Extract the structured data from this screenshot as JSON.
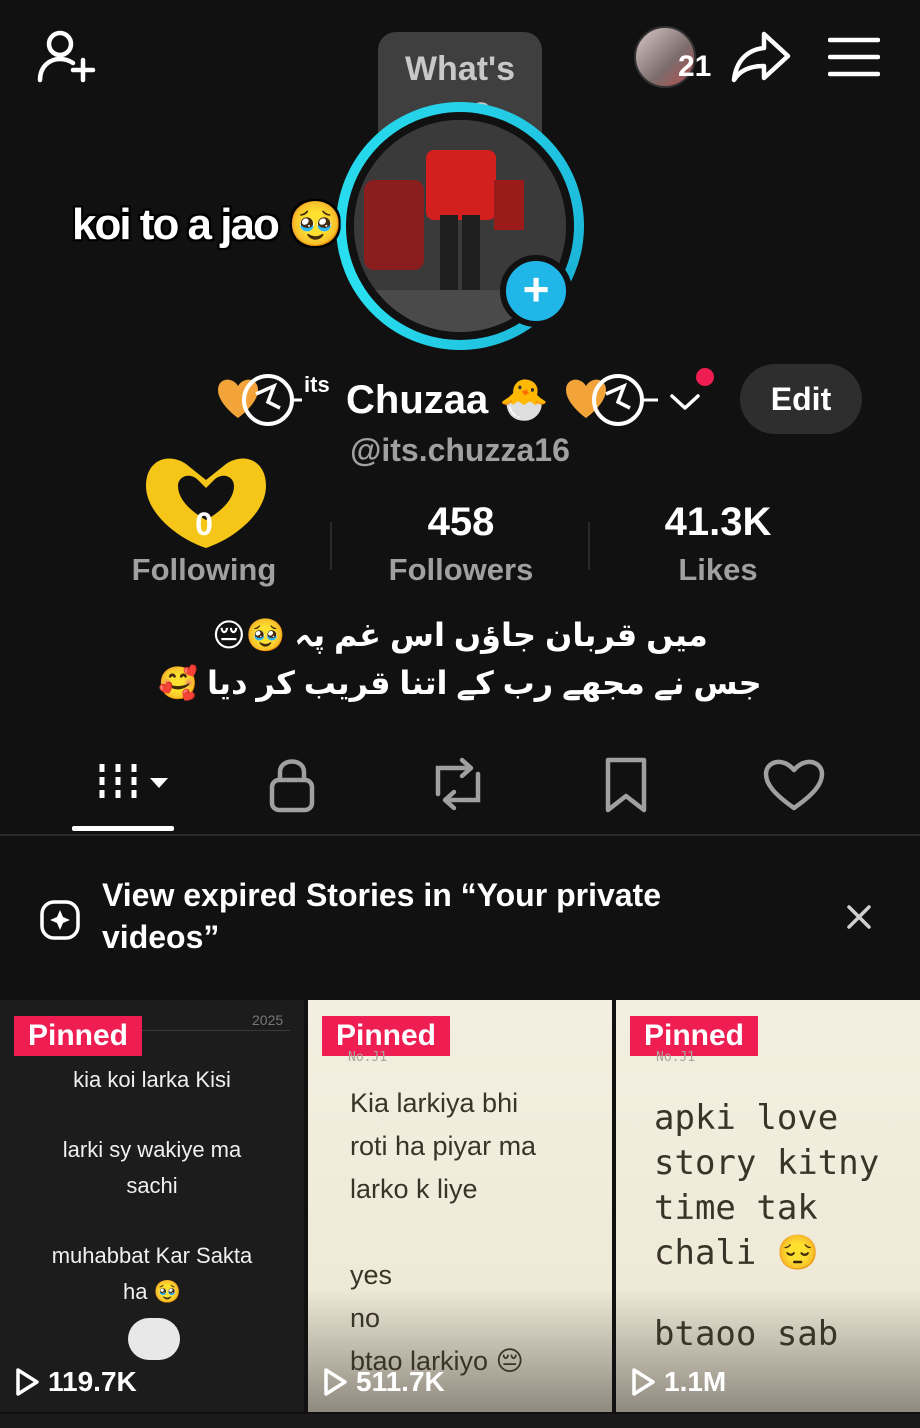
{
  "top_bar": {
    "add_friend_icon": "add-user-icon",
    "bubble_text": "What's up?",
    "visitors_count": "21",
    "share_icon": "share-icon",
    "menu_icon": "menu-icon"
  },
  "story_sticker": {
    "text": "koi to a jao",
    "emoji": "🥹"
  },
  "profile": {
    "name_prefix": "its",
    "name": "Chuzaa",
    "name_emoji": "🐣",
    "handle": "@its.chuzza16",
    "edit_label": "Edit"
  },
  "stats": {
    "following": {
      "value": "0",
      "label": "Following"
    },
    "followers": {
      "value": "458",
      "label": "Followers"
    },
    "likes": {
      "value": "41.3K",
      "label": "Likes"
    }
  },
  "bio": {
    "line1": "میں قربان جاؤں اس غم پہ 🥹😔",
    "line2": "جس نے مجھے رب کے اتنا قریب کر دیا 🥰"
  },
  "tabs": [
    "videos-grid-icon",
    "lock-icon",
    "repost-icon",
    "bookmark-icon",
    "heart-icon"
  ],
  "banner": {
    "text": "View expired Stories in “Your private videos”"
  },
  "videos": [
    {
      "pinned": "Pinned",
      "year": "2025",
      "lines": [
        "kia koi larka Kisi",
        "larki sy wakiye ma",
        "sachi",
        "muhabbat Kar Sakta",
        "ha 🥹"
      ],
      "views": "119.7K"
    },
    {
      "pinned": "Pinned",
      "tag": "No.J1",
      "lines": [
        "Kia larkiya bhi",
        "roti ha piyar ma",
        "larko k liye",
        "yes",
        "no",
        "btao larkiyo 😔"
      ],
      "views": "511.7K"
    },
    {
      "pinned": "Pinned",
      "tag": "No.J1",
      "lines": [
        "apki love",
        "story kitny",
        "time tak",
        "chali 😔",
        "btaoo sab"
      ],
      "views": "1.1M"
    }
  ],
  "colors": {
    "background": "#111111",
    "pinned": "#ee1d52",
    "accent": "#20b6e8",
    "muted": "#a0a0a0"
  }
}
